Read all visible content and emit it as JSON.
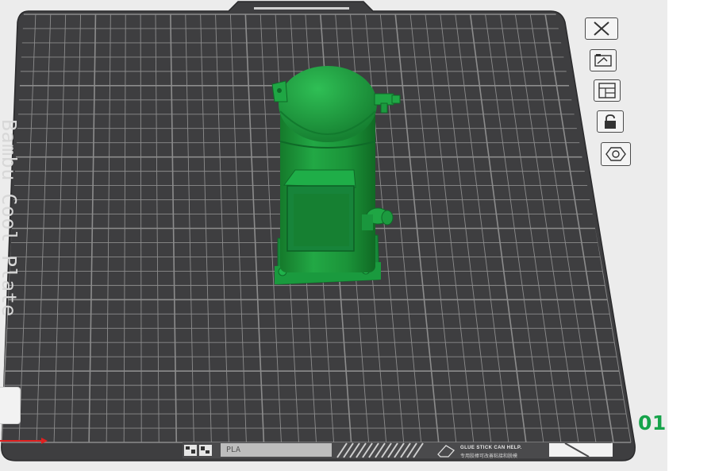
{
  "plate": {
    "name": "Bambu Cool Plate",
    "number": "01",
    "filament": "PLA",
    "glue_note_line1": "GLUE STICK CAN HELP.",
    "glue_note_line2": "专用胶棒可改善粘接和脱模"
  },
  "toolbar": {
    "items": [
      {
        "name": "close-icon",
        "label": "Remove plate"
      },
      {
        "name": "auto-orient-icon",
        "label": "Auto orient"
      },
      {
        "name": "arrange-icon",
        "label": "Arrange"
      },
      {
        "name": "lock-icon",
        "label": "Lock plate"
      },
      {
        "name": "plate-settings-icon",
        "label": "Plate settings"
      }
    ]
  },
  "colors": {
    "viewport_bg": "#ececec",
    "plate": "#3e3e40",
    "grid": "#8c8c8c",
    "model": "#1f9e3c",
    "plate_number": "#16a34a",
    "axis_x": "#e02020"
  }
}
